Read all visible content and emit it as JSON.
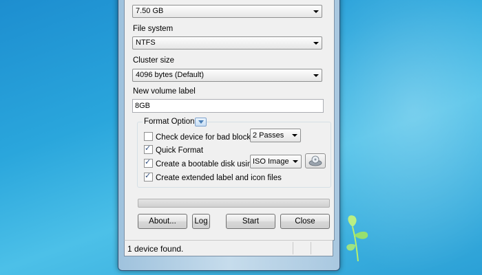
{
  "window": {
    "capacity_value": "7.50 GB",
    "file_system": {
      "label": "File system",
      "value": "NTFS"
    },
    "cluster_size": {
      "label": "Cluster size",
      "value": "4096 bytes (Default)"
    },
    "volume_label": {
      "label": "New volume label",
      "value": "8GB"
    },
    "format_options": {
      "title": "Format Options",
      "bad_blocks": {
        "label": "Check device for bad blocks:",
        "checked": false,
        "passes": "2 Passes"
      },
      "quick_format": {
        "label": "Quick Format",
        "checked": true
      },
      "bootable": {
        "label": "Create a bootable disk using:",
        "checked": true,
        "type": "ISO Image"
      },
      "extended_label": {
        "label": "Create extended label and icon files",
        "checked": true
      }
    },
    "progress": 0,
    "buttons": {
      "about": "About...",
      "log": "Log",
      "start": "Start",
      "close": "Close"
    },
    "status": "1 device found."
  }
}
